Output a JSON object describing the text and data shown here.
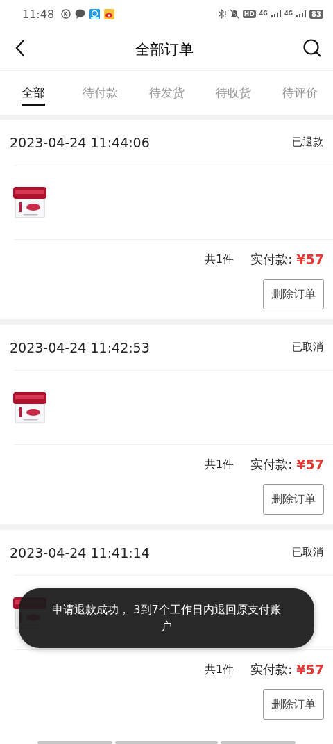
{
  "status_bar": {
    "time": "11:48",
    "hd_label": "HD",
    "network_labels": [
      "4G",
      "4G"
    ],
    "battery": "83"
  },
  "header": {
    "title": "全部订单"
  },
  "tabs": [
    {
      "label": "全部",
      "selected": true
    },
    {
      "label": "待付款",
      "selected": false
    },
    {
      "label": "待发货",
      "selected": false
    },
    {
      "label": "待收货",
      "selected": false
    },
    {
      "label": "待评价",
      "selected": false
    }
  ],
  "orders": [
    {
      "date": "2023-04-24 11:44:06",
      "status": "已退款",
      "count": "共1件",
      "paid_label": "实付款:",
      "amount": "¥57",
      "button": "删除订单"
    },
    {
      "date": "2023-04-24 11:42:53",
      "status": "已取消",
      "count": "共1件",
      "paid_label": "实付款:",
      "amount": "¥57",
      "button": "删除订单"
    },
    {
      "date": "2023-04-24 11:41:14",
      "status": "已取消",
      "count": "共1件",
      "paid_label": "实付款:",
      "amount": "¥57",
      "button": "删除订单"
    }
  ],
  "toast": {
    "message": "申请退款成功， 3到7个工作日内退回原支付账户"
  }
}
